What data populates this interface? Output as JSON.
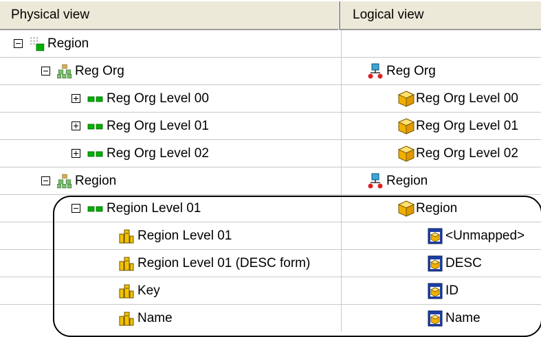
{
  "header": {
    "physical": "Physical view",
    "logical": "Logical view"
  },
  "rows": [
    {
      "physical": "Region",
      "logical": ""
    },
    {
      "physical": "Reg Org",
      "logical": "Reg Org"
    },
    {
      "physical": "Reg Org Level 00",
      "logical": "Reg Org Level 00"
    },
    {
      "physical": "Reg Org Level 01",
      "logical": "Reg Org Level 01"
    },
    {
      "physical": "Reg Org Level 02",
      "logical": "Reg Org Level 02"
    },
    {
      "physical": "Region",
      "logical": "Region"
    },
    {
      "physical": "Region Level 01",
      "logical": "Region"
    },
    {
      "physical": "Region Level 01",
      "logical": "<Unmapped>"
    },
    {
      "physical": "Region Level 01 (DESC form)",
      "logical": "DESC"
    },
    {
      "physical": "Key",
      "logical": "ID"
    },
    {
      "physical": "Name",
      "logical": "Name"
    }
  ],
  "icons": {
    "root": "region-dimension-icon",
    "hierarchy": "hierarchy-icon",
    "level": "level-icon",
    "attribute": "attribute-icon",
    "logical_hierarchy": "logical-hierarchy-icon",
    "logical_level": "cube-icon",
    "logical_attribute": "attribute-box-icon"
  },
  "colors": {
    "header_bg": "#ece9d8",
    "level_green": "#00a000",
    "cube_yellow": "#f2c200",
    "row_border": "#c8c8c8"
  }
}
